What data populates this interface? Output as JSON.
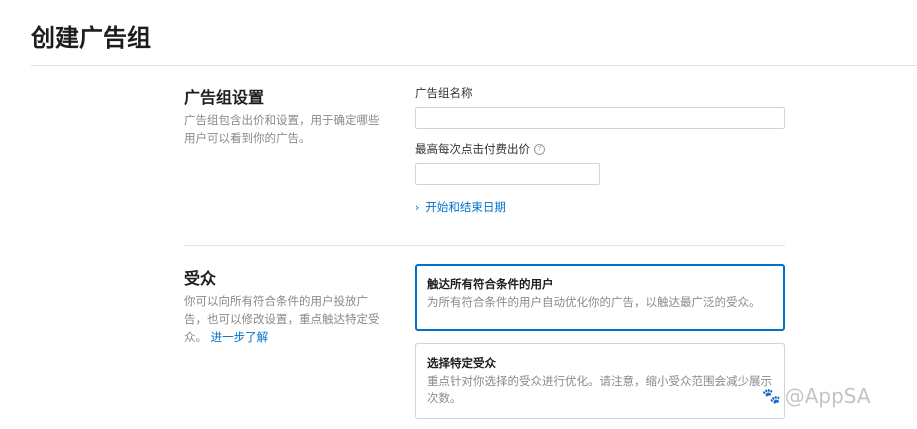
{
  "page": {
    "title": "创建广告组"
  },
  "settings": {
    "heading": "广告组设置",
    "description": "广告组包含出价和设置，用于确定哪些用户可以看到你的广告。",
    "name_label": "广告组名称",
    "name_value": "",
    "max_cpt_label": "最高每次点击付费出价",
    "help_icon": "?",
    "max_cpt_value": "",
    "date_link": "开始和结束日期",
    "chevron_icon": "›"
  },
  "audience": {
    "heading": "受众",
    "description": "你可以向所有符合条件的用户投放广告，也可以修改设置，重点触达特定受众。",
    "learn_more": "进一步了解",
    "options": [
      {
        "title": "触达所有符合条件的用户",
        "description": "为所有符合条件的用户自动优化你的广告，以触达最广泛的受众。",
        "selected": true
      },
      {
        "title": "选择特定受众",
        "description": "重点针对你选择的受众进行优化。请注意，缩小受众范围会减少展示次数。",
        "selected": false
      }
    ]
  },
  "watermark": {
    "text": "@AppSA",
    "icon": "paw-icon"
  }
}
